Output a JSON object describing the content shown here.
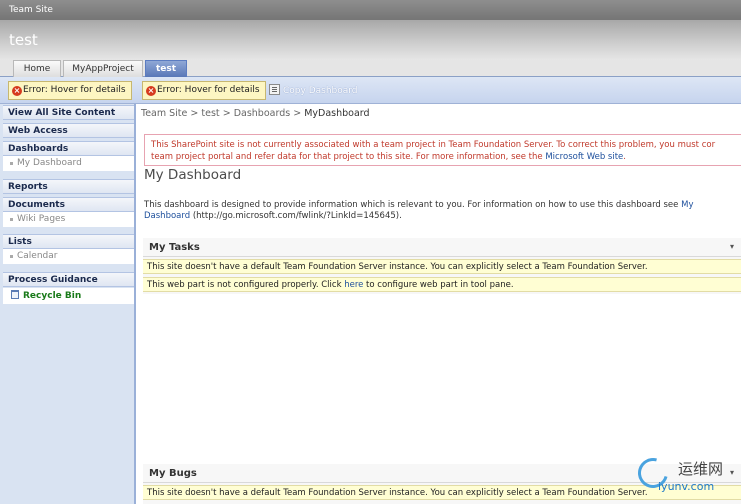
{
  "header": {
    "site_name": "Team Site",
    "title": "test",
    "tabs": [
      {
        "label": "Home"
      },
      {
        "label": "MyAppProject"
      },
      {
        "label": "test"
      }
    ]
  },
  "toolbar": {
    "error_label_1": "Error: Hover for details",
    "error_label_2": "Error: Hover for details",
    "copy_label": "Copy Dashboard"
  },
  "nav": {
    "view_all": "View All Site Content",
    "web_access": "Web Access",
    "dashboards": "Dashboards",
    "my_dashboard": "My Dashboard",
    "reports": "Reports",
    "documents": "Documents",
    "wiki_pages": "Wiki Pages",
    "lists": "Lists",
    "calendar": "Calendar",
    "process_guidance": "Process Guidance",
    "recycle_bin": "Recycle Bin"
  },
  "breadcrumb": {
    "team_site": "Team Site",
    "test": "test",
    "dashboards": "Dashboards",
    "current": "MyDashboard",
    "separator": ">"
  },
  "warning": {
    "line1": "This SharePoint site is not currently associated with a team project in Team Foundation Server. To correct this problem, you must cor",
    "line2_pre": "team project portal and refer data for that project to this site. For more information, see the ",
    "link": "Microsoft Web site",
    "line2_post": "."
  },
  "main": {
    "title": "My Dashboard",
    "desc_pre": "This dashboard is designed to provide information which is relevant to you. For information on how to use this dashboard see ",
    "desc_link": "My Dashboard",
    "desc_post": " (http://go.microsoft.com/fwlink/?LinkId=145645)."
  },
  "webparts": {
    "tasks": {
      "title": "My Tasks",
      "menu": "▾",
      "notice1": "This site doesn't have a default Team Foundation Server instance. You can explicitly select a Team Foundation Server.",
      "notice2_pre": "This web part is not configured properly. Click ",
      "notice2_link": "here",
      "notice2_post": " to configure web part in tool pane."
    },
    "bugs": {
      "title": "My Bugs",
      "menu": "▾",
      "notice1": "This site doesn't have a default Team Foundation Server instance. You can explicitly select a Team Foundation Server."
    }
  },
  "watermark": {
    "cn": "运维网",
    "url": "iyunv.com"
  },
  "colors": {
    "accent": "#5877b8",
    "error": "#c0392b",
    "link": "#1d4f9c",
    "notice_bg": "#fffed3"
  }
}
